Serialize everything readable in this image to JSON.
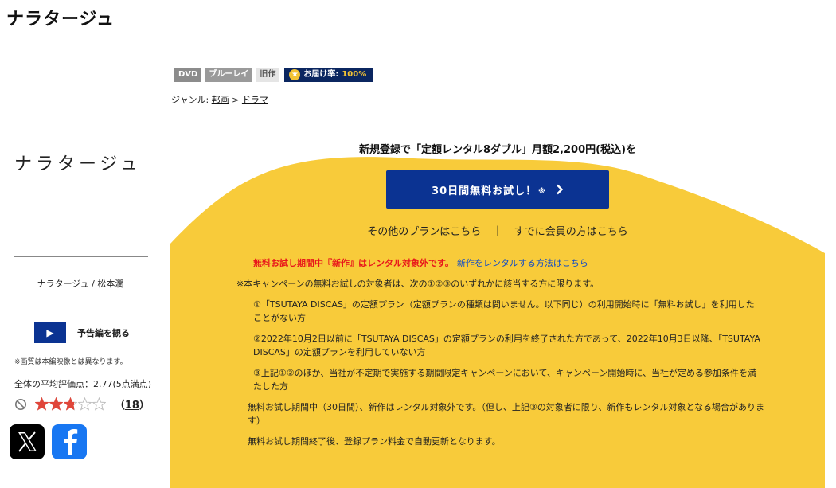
{
  "page": {
    "title": "ナラタージュ"
  },
  "badges": {
    "dvd": "DVD",
    "bluray": "ブルーレイ",
    "old": "旧作",
    "delivery_label": "お届け率:",
    "delivery_value": "100%"
  },
  "genre": {
    "label": "ジャンル:",
    "level1": "邦画",
    "separator": ">",
    "level2": "ドラマ"
  },
  "poster": {
    "title": "ナラタージュ",
    "caption": "ナラタージュ / 松本潤"
  },
  "trailer": {
    "label": "予告編を観る"
  },
  "rating": {
    "image_note": "※画質は本編映像とは異なります。",
    "average_text": "全体の平均評価点：2.77(5点満点)",
    "stars_filled": 2.77,
    "stars_max": 5,
    "review_count_open": "（",
    "review_count": "18",
    "review_count_close": "）"
  },
  "campaign": {
    "heading": "新規登録で「定額レンタル8ダブル」月額2,200円(税込)を",
    "cta_label": "30日間無料お試し！",
    "cta_note": "※",
    "other_plans": "その他のプランはこちら",
    "link_separator": "｜",
    "member_link": "すでに会員の方はこちら",
    "notice_red": "無料お試し期間中『新作』はレンタル対象外です。",
    "notice_link": "新作をレンタルする方法はこちら",
    "terms_intro": "※本キャンペーンの無料お試しの対象者は、次の①②③のいずれかに該当する方に限ります。",
    "conditions": [
      "①「TSUTAYA DISCAS」の定額プラン（定額プランの種類は問いません。以下同じ）の利用開始時に「無料お試し」を利用したことがない方",
      "②2022年10月2日以前に「TSUTAYA DISCAS」の定額プランの利用を終了された方であって、2022年10月3日以降、「TSUTAYA DISCAS」の定額プランを利用していない方",
      "③上記①②のほか、当社が不定期で実施する期間限定キャンペーンにおいて、キャンペーン開始時に、当社が定める参加条件を満たした方"
    ],
    "trial_note": "無料お試し期間中（30日間）、新作はレンタル対象外です。（但し、上記③の対象者に限り、新作もレンタル対象となる場合があります）",
    "renewal_note": "無料お試し期間終了後、登録プラン料金で自動更新となります。"
  },
  "colors": {
    "brand_navy": "#0b3392",
    "campaign_yellow": "#f8cb3a",
    "notice_red": "#e8161b",
    "link_blue": "#0b49c9",
    "star_red": "#e0463a"
  },
  "icons": {
    "play": "play-icon",
    "chevron": "chevron-right-icon",
    "ban": "ban-icon",
    "star": "star-icon",
    "x_logo": "x-logo-icon",
    "facebook_logo": "facebook-logo-icon"
  }
}
